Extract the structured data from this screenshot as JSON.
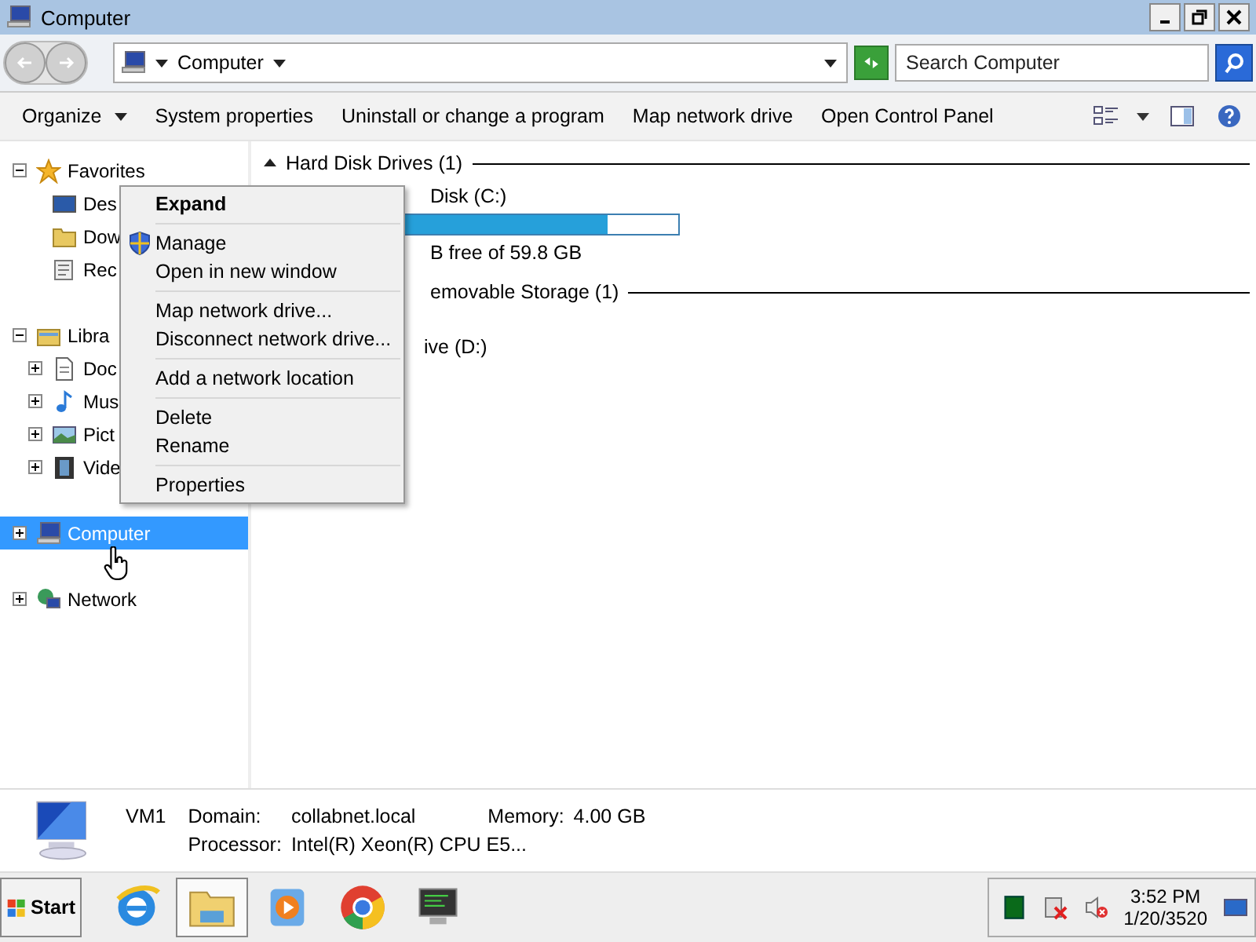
{
  "window": {
    "title": "Computer"
  },
  "address": {
    "path": "Computer"
  },
  "search": {
    "placeholder": "Search Computer"
  },
  "toolbar": [
    {
      "label": "Organize",
      "dropdown": true
    },
    {
      "label": "System properties",
      "dropdown": false
    },
    {
      "label": "Uninstall or change a program",
      "dropdown": false
    },
    {
      "label": "Map network drive",
      "dropdown": false
    },
    {
      "label": "Open Control Panel",
      "dropdown": false
    }
  ],
  "nav": [
    {
      "label": "Favorites",
      "expanded": true,
      "selected": false,
      "children": [
        {
          "label": "Des",
          "selected": false
        },
        {
          "label": "Dow",
          "selected": false
        },
        {
          "label": "Rec",
          "selected": false
        }
      ]
    },
    {
      "label": "Libra",
      "expanded": true,
      "selected": false,
      "children": [
        {
          "label": "Doc",
          "expanded": false,
          "selected": false
        },
        {
          "label": "Mus",
          "expanded": false,
          "selected": false
        },
        {
          "label": "Pict",
          "expanded": false,
          "selected": false
        },
        {
          "label": "Vide",
          "expanded": false,
          "selected": false
        }
      ]
    },
    {
      "label": "Computer",
      "expanded": false,
      "selected": true
    },
    {
      "label": "Network",
      "expanded": false,
      "selected": false
    }
  ],
  "sections": [
    {
      "title": "Hard Disk Drives (1)",
      "items": [
        {
          "kind": "disk",
          "name": "Disk (C:)",
          "level": 0.76,
          "free": "B free of 59.8 GB"
        }
      ]
    },
    {
      "title": "emovable Storage (1)",
      "items": [
        {
          "kind": "cd",
          "name": "ive (D:)"
        }
      ]
    }
  ],
  "context_menu": [
    {
      "kind": "item",
      "label": "Expand",
      "default": true
    },
    {
      "kind": "separator"
    },
    {
      "kind": "admin-item",
      "label": "Manage",
      "default": false
    },
    {
      "kind": "item",
      "label": "Open in new window",
      "default": false
    },
    {
      "kind": "separator"
    },
    {
      "kind": "item",
      "label": "Map network drive...",
      "default": false
    },
    {
      "kind": "item",
      "label": "Disconnect network drive...",
      "default": false
    },
    {
      "kind": "separator"
    },
    {
      "kind": "item",
      "label": "Add a network location",
      "default": false
    },
    {
      "kind": "separator"
    },
    {
      "kind": "item",
      "label": "Delete",
      "default": false
    },
    {
      "kind": "item",
      "label": "Rename",
      "default": false
    },
    {
      "kind": "separator"
    },
    {
      "kind": "item",
      "label": "Properties",
      "default": false
    }
  ],
  "details": {
    "name": "VM1",
    "fields": [
      {
        "label": "Domain:",
        "value": "collabnet.local"
      },
      {
        "label": "Memory:",
        "value": "4.00 GB"
      },
      {
        "label": "Processor:",
        "value": "Intel(R) Xeon(R) CPU E5..."
      }
    ]
  },
  "taskbar": {
    "start": "Start",
    "apps": [
      {
        "selected": false
      },
      {
        "selected": true
      },
      {
        "selected": false
      },
      {
        "selected": false
      },
      {
        "selected": false
      }
    ],
    "time": "3:52 PM",
    "date": "1/20/3520"
  }
}
